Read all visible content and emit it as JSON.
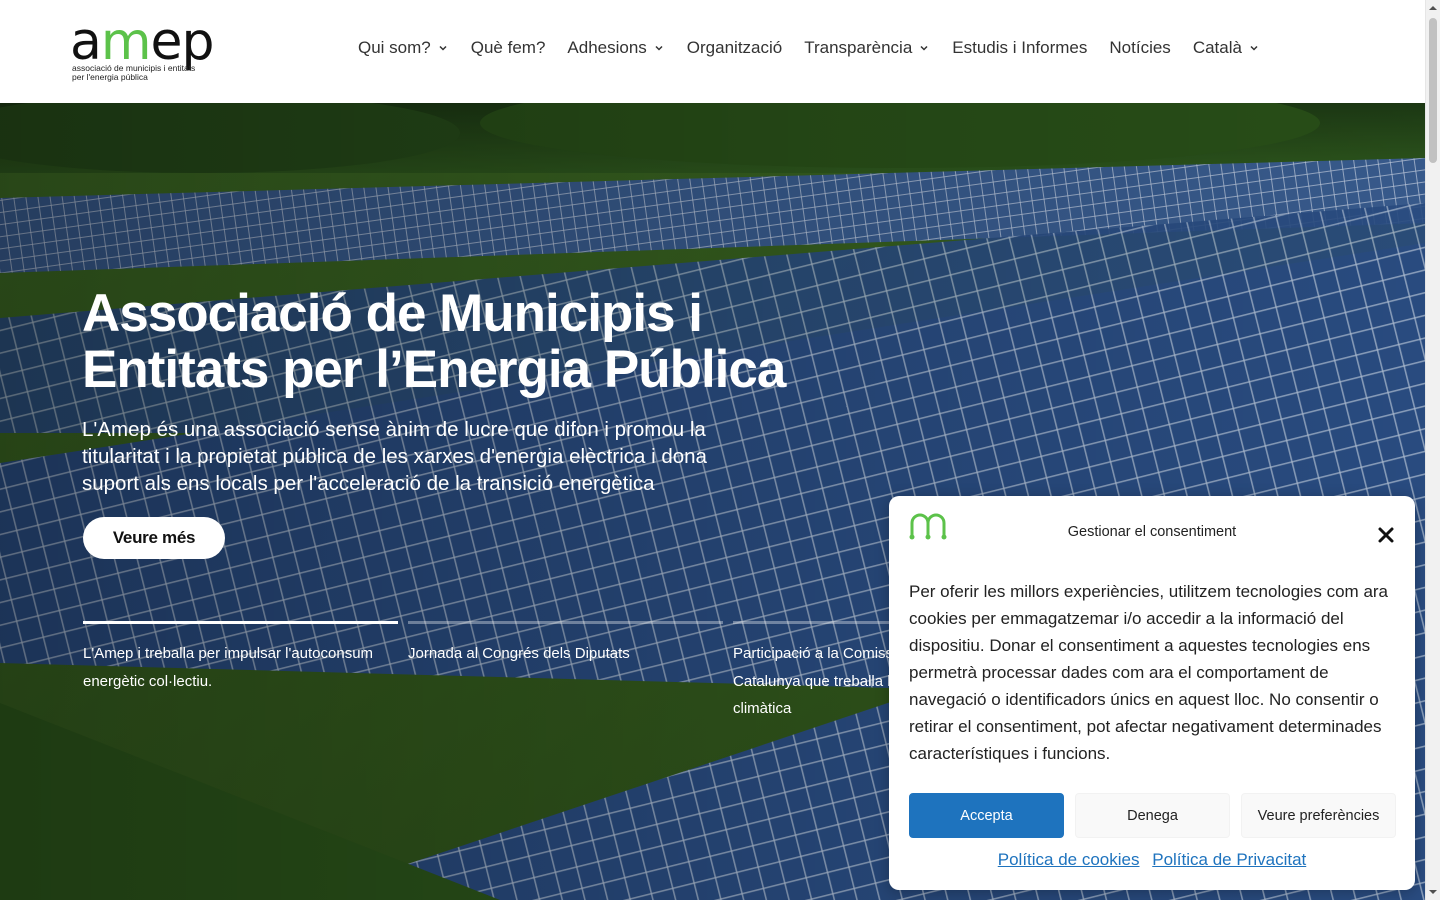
{
  "header": {
    "logo": {
      "word_a": "a",
      "word_m": "m",
      "word_ep": "ep",
      "subtitle_line1": "associació de municipis i entitats",
      "subtitle_line2": "per l'energia pública"
    },
    "nav": [
      {
        "label": "Qui som?",
        "has_dropdown": true
      },
      {
        "label": "Què fem?",
        "has_dropdown": false
      },
      {
        "label": "Adhesions",
        "has_dropdown": true
      },
      {
        "label": "Organització",
        "has_dropdown": false
      },
      {
        "label": "Transparència",
        "has_dropdown": true
      },
      {
        "label": "Estudis i Informes",
        "has_dropdown": false
      },
      {
        "label": "Notícies",
        "has_dropdown": false
      },
      {
        "label": "Català",
        "has_dropdown": true
      }
    ]
  },
  "hero": {
    "title": "Associació de Municipis i Entitats per l’Energia Pública",
    "description": "L'Amep és una associació sense ànim de lucre que difon i promou la titularitat i la propietat pública de les xarxes d'energia elèctrica i dona suport als ens locals per l'acceleració de la transició energètica",
    "button_label": "Veure més",
    "slides": [
      {
        "text": "L'Amep i treballa per impulsar l'autoconsum energètic col·lectiu.",
        "progress": 1.0
      },
      {
        "text": "Jornada al Congrés dels Diputats",
        "progress": 0.0
      },
      {
        "text": "Participació a la Comissió Parlament de Catalunya que treballa la llei sobre seguretat climàtica",
        "progress": 0.0
      }
    ]
  },
  "cookie": {
    "title": "Gestionar el consentiment",
    "body": "Per oferir les millors experiències, utilitzem tecnologies com ara cookies per emmagatzemar i/o accedir a la informació del dispositiu. Donar el consentiment a aquestes tecnologies ens permetrà processar dades com ara el comportament de navegació o identificadors únics en aquest lloc. No consentir o retirar el consentiment, pot afectar negativament determinades característiques i funcions.",
    "accept_label": "Accepta",
    "deny_label": "Denega",
    "preferences_label": "Veure preferències",
    "cookie_policy_label": "Política de cookies",
    "privacy_policy_label": "Política de Privacitat"
  },
  "colors": {
    "brand_green": "#5cc24a",
    "accept_blue": "#1e73be",
    "panel_blue": "#2c4f86"
  },
  "icons": {
    "nav_dropdown": "chevron-down-icon",
    "close": "close-icon"
  }
}
